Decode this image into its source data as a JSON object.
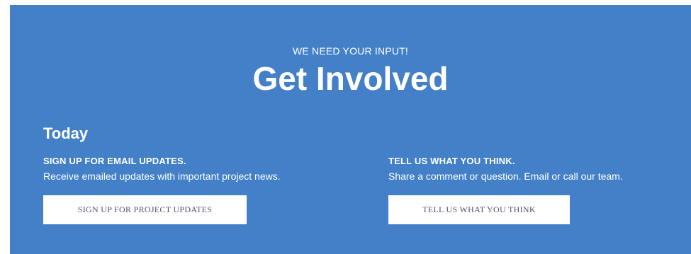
{
  "header": {
    "eyebrow": "WE NEED YOUR INPUT!",
    "title": "Get Involved"
  },
  "section": {
    "title": "Today"
  },
  "columns": [
    {
      "heading": "SIGN UP FOR EMAIL UPDATES.",
      "text": "Receive emailed updates with important project news.",
      "button_label": "SIGN UP FOR PROJECT UPDATES"
    },
    {
      "heading": "TELL US WHAT YOU THINK.",
      "text": "Share a comment or question. Email or call our team.",
      "button_label": "TELL US WHAT YOU THINK"
    }
  ],
  "colors": {
    "panel_background": "#4380c8",
    "text": "#ffffff",
    "button_background": "#ffffff",
    "button_text": "#5a4e73"
  }
}
